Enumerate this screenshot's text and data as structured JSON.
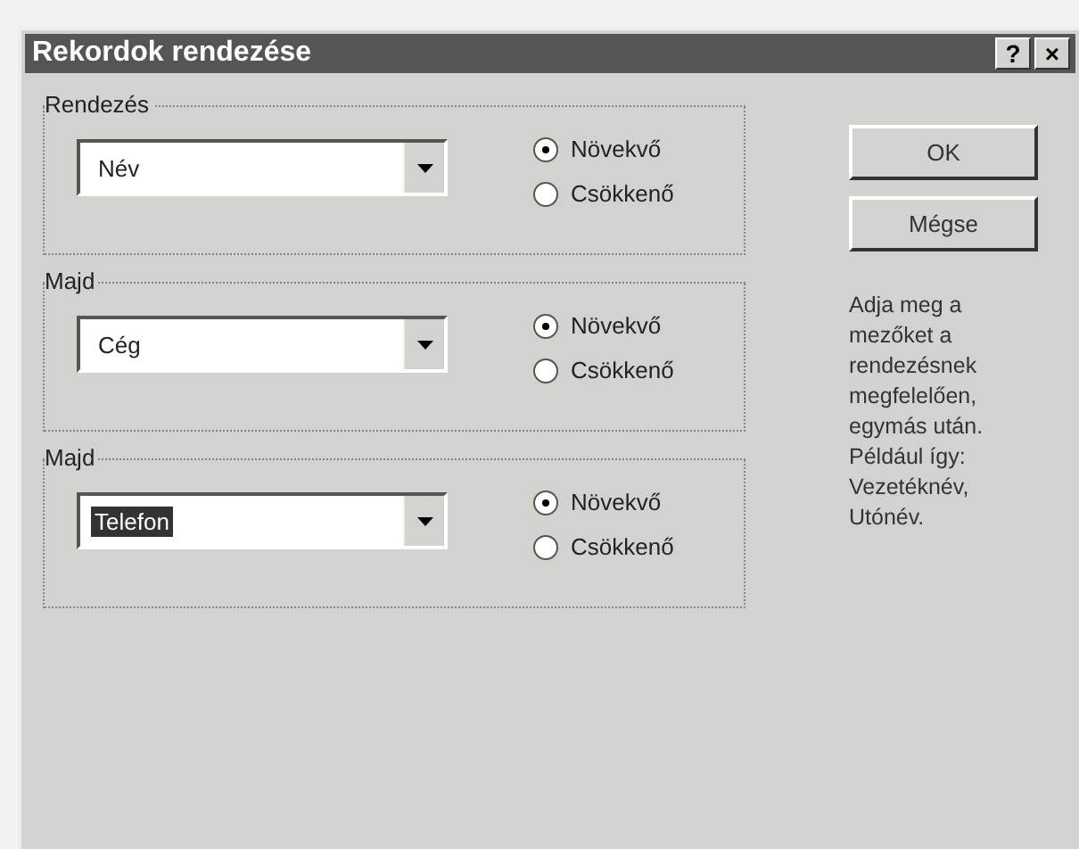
{
  "window": {
    "title": "Rekordok rendezése",
    "help_button": "?",
    "close_button": "×"
  },
  "groups": [
    {
      "label": "Rendezés",
      "field": {
        "value": "Név",
        "highlighted": false
      },
      "options": [
        {
          "label": "Növekvő",
          "selected": true
        },
        {
          "label": "Csökkenő",
          "selected": false
        }
      ]
    },
    {
      "label": "Majd",
      "field": {
        "value": "Cég",
        "highlighted": false
      },
      "options": [
        {
          "label": "Növekvő",
          "selected": true
        },
        {
          "label": "Csökkenő",
          "selected": false
        }
      ]
    },
    {
      "label": "Majd",
      "field": {
        "value": "Telefon",
        "highlighted": true
      },
      "options": [
        {
          "label": "Növekvő",
          "selected": true
        },
        {
          "label": "Csökkenő",
          "selected": false
        }
      ]
    }
  ],
  "buttons": [
    "OK",
    "Mégse"
  ],
  "help_text": "Adja meg a mezőket a rendezésnek megfelelően, egymás után. Például így: Vezetéknév, Utónév."
}
